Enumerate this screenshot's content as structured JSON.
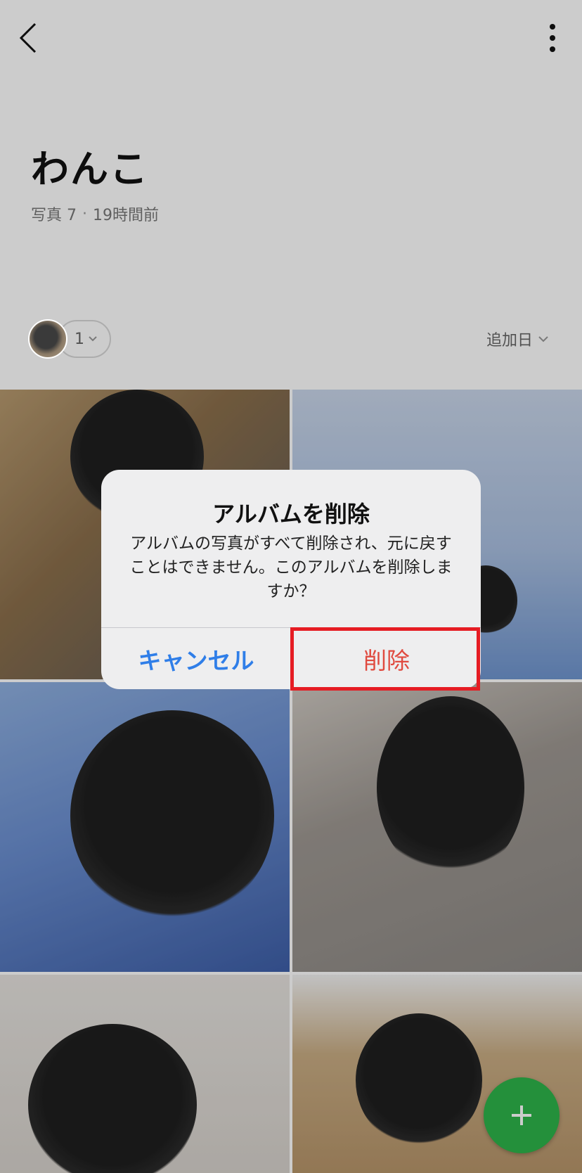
{
  "header": {
    "back_icon": "chevron-left-icon",
    "more_icon": "more-vertical-icon",
    "title": "わんこ",
    "photo_count_label": "写真 7",
    "separator": "·",
    "updated": "19時間前"
  },
  "members": {
    "count": "1"
  },
  "sort": {
    "label": "追加日"
  },
  "dialog": {
    "title": "アルバムを削除",
    "message": "アルバムの写真がすべて削除され、元に戻すことはできません。このアルバムを削除しますか？",
    "cancel_label": "キャンセル",
    "delete_label": "削除"
  },
  "fab": {
    "icon": "plus-icon"
  },
  "colors": {
    "accent_green": "#2db54a",
    "cancel_blue": "#2f7ee8",
    "delete_red": "#e04a3f",
    "highlight_red": "#e51c23"
  }
}
